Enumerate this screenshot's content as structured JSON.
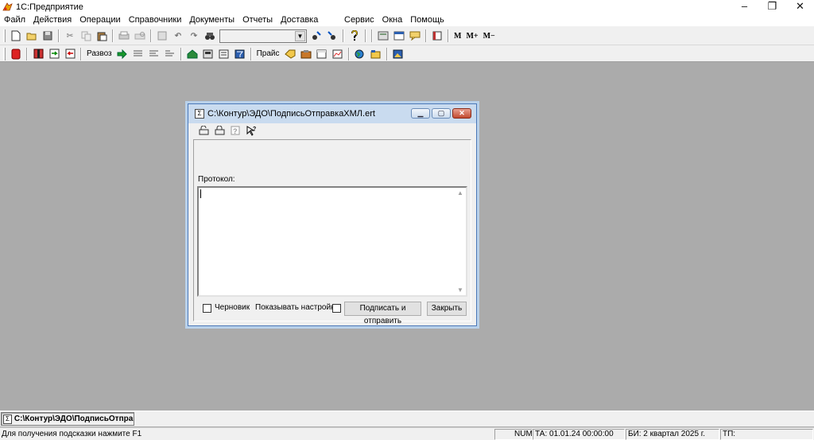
{
  "window": {
    "title": "1С:Предприятие",
    "minimize": "–",
    "maximize": "❐",
    "close": "✕"
  },
  "menu": {
    "left": [
      "Файл",
      "Действия",
      "Операции",
      "Справочники",
      "Документы",
      "Отчеты",
      "Доставка"
    ],
    "right": [
      "Сервис",
      "Окна",
      "Помощь"
    ]
  },
  "toolbar2": {
    "razvoz": "Развоз",
    "price": "Прайс"
  },
  "toolbar1": {
    "m": "M",
    "m_plus": "M+",
    "m_minus": "M−"
  },
  "dialog": {
    "title": "C:\\Контур\\ЭДО\\ПодписьОтправкаXMЛ.ert",
    "protocol_label": "Протокол:",
    "draft_label": "Черновик",
    "show_settings_label": "Показывать настройки",
    "sign_send_button": "Подписать и отправить",
    "close_button": "Закрыть"
  },
  "mdi_tab": {
    "label": "C:\\Контур\\ЭДО\\ПодписьОтправк..."
  },
  "status": {
    "hint": "Для получения подсказки нажмите F1",
    "num": "NUM",
    "ta": "ТА: 01.01.24  00:00:00",
    "bi": "БИ: 2 квартал 2025 г.",
    "tp": "ТП:"
  },
  "colors": {
    "mdi_background": "#ababab",
    "dialog_border": "#4b78b8",
    "close_button": "#c24a30"
  }
}
